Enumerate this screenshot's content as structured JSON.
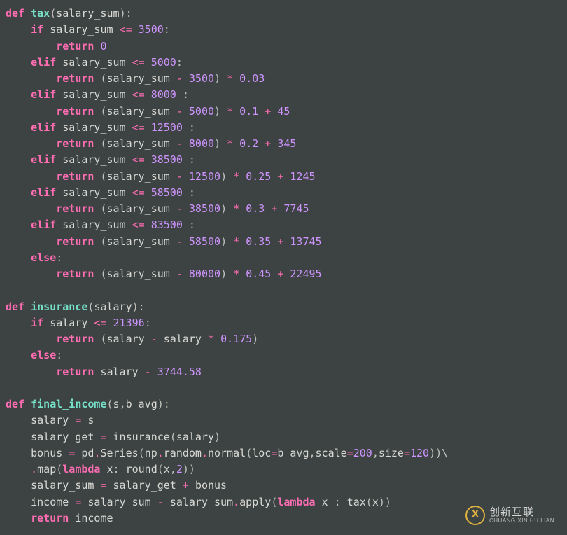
{
  "code": {
    "lines": [
      [
        [
          "kw",
          "def "
        ],
        [
          "fn",
          "tax"
        ],
        [
          "pun",
          "("
        ],
        [
          "id",
          "salary_sum"
        ],
        [
          "pun",
          "):"
        ]
      ],
      [
        [
          "pun",
          "    "
        ],
        [
          "kw",
          "if"
        ],
        [
          "pun",
          " "
        ],
        [
          "id",
          "salary_sum"
        ],
        [
          "pun",
          " "
        ],
        [
          "op",
          "<="
        ],
        [
          "pun",
          " "
        ],
        [
          "num",
          "3500"
        ],
        [
          "pun",
          ":"
        ]
      ],
      [
        [
          "pun",
          "        "
        ],
        [
          "kw",
          "return"
        ],
        [
          "pun",
          " "
        ],
        [
          "num",
          "0"
        ]
      ],
      [
        [
          "pun",
          "    "
        ],
        [
          "kw",
          "elif"
        ],
        [
          "pun",
          " "
        ],
        [
          "id",
          "salary_sum"
        ],
        [
          "pun",
          " "
        ],
        [
          "op",
          "<="
        ],
        [
          "pun",
          " "
        ],
        [
          "num",
          "5000"
        ],
        [
          "pun",
          ":"
        ]
      ],
      [
        [
          "pun",
          "        "
        ],
        [
          "kw",
          "return"
        ],
        [
          "pun",
          " ("
        ],
        [
          "id",
          "salary_sum"
        ],
        [
          "pun",
          " "
        ],
        [
          "op",
          "-"
        ],
        [
          "pun",
          " "
        ],
        [
          "num",
          "3500"
        ],
        [
          "pun",
          ") "
        ],
        [
          "op",
          "*"
        ],
        [
          "pun",
          " "
        ],
        [
          "num",
          "0.03"
        ]
      ],
      [
        [
          "pun",
          "    "
        ],
        [
          "kw",
          "elif"
        ],
        [
          "pun",
          " "
        ],
        [
          "id",
          "salary_sum"
        ],
        [
          "pun",
          " "
        ],
        [
          "op",
          "<="
        ],
        [
          "pun",
          " "
        ],
        [
          "num",
          "8000"
        ],
        [
          "pun",
          " :"
        ]
      ],
      [
        [
          "pun",
          "        "
        ],
        [
          "kw",
          "return"
        ],
        [
          "pun",
          " ("
        ],
        [
          "id",
          "salary_sum"
        ],
        [
          "pun",
          " "
        ],
        [
          "op",
          "-"
        ],
        [
          "pun",
          " "
        ],
        [
          "num",
          "5000"
        ],
        [
          "pun",
          ") "
        ],
        [
          "op",
          "*"
        ],
        [
          "pun",
          " "
        ],
        [
          "num",
          "0.1"
        ],
        [
          "pun",
          " "
        ],
        [
          "op",
          "+"
        ],
        [
          "pun",
          " "
        ],
        [
          "num",
          "45"
        ]
      ],
      [
        [
          "pun",
          "    "
        ],
        [
          "kw",
          "elif"
        ],
        [
          "pun",
          " "
        ],
        [
          "id",
          "salary_sum"
        ],
        [
          "pun",
          " "
        ],
        [
          "op",
          "<="
        ],
        [
          "pun",
          " "
        ],
        [
          "num",
          "12500"
        ],
        [
          "pun",
          " :"
        ]
      ],
      [
        [
          "pun",
          "        "
        ],
        [
          "kw",
          "return"
        ],
        [
          "pun",
          " ("
        ],
        [
          "id",
          "salary_sum"
        ],
        [
          "pun",
          " "
        ],
        [
          "op",
          "-"
        ],
        [
          "pun",
          " "
        ],
        [
          "num",
          "8000"
        ],
        [
          "pun",
          ") "
        ],
        [
          "op",
          "*"
        ],
        [
          "pun",
          " "
        ],
        [
          "num",
          "0.2"
        ],
        [
          "pun",
          " "
        ],
        [
          "op",
          "+"
        ],
        [
          "pun",
          " "
        ],
        [
          "num",
          "345"
        ]
      ],
      [
        [
          "pun",
          "    "
        ],
        [
          "kw",
          "elif"
        ],
        [
          "pun",
          " "
        ],
        [
          "id",
          "salary_sum"
        ],
        [
          "pun",
          " "
        ],
        [
          "op",
          "<="
        ],
        [
          "pun",
          " "
        ],
        [
          "num",
          "38500"
        ],
        [
          "pun",
          " :"
        ]
      ],
      [
        [
          "pun",
          "        "
        ],
        [
          "kw",
          "return"
        ],
        [
          "pun",
          " ("
        ],
        [
          "id",
          "salary_sum"
        ],
        [
          "pun",
          " "
        ],
        [
          "op",
          "-"
        ],
        [
          "pun",
          " "
        ],
        [
          "num",
          "12500"
        ],
        [
          "pun",
          ") "
        ],
        [
          "op",
          "*"
        ],
        [
          "pun",
          " "
        ],
        [
          "num",
          "0.25"
        ],
        [
          "pun",
          " "
        ],
        [
          "op",
          "+"
        ],
        [
          "pun",
          " "
        ],
        [
          "num",
          "1245"
        ]
      ],
      [
        [
          "pun",
          "    "
        ],
        [
          "kw",
          "elif"
        ],
        [
          "pun",
          " "
        ],
        [
          "id",
          "salary_sum"
        ],
        [
          "pun",
          " "
        ],
        [
          "op",
          "<="
        ],
        [
          "pun",
          " "
        ],
        [
          "num",
          "58500"
        ],
        [
          "pun",
          " :"
        ]
      ],
      [
        [
          "pun",
          "        "
        ],
        [
          "kw",
          "return"
        ],
        [
          "pun",
          " ("
        ],
        [
          "id",
          "salary_sum"
        ],
        [
          "pun",
          " "
        ],
        [
          "op",
          "-"
        ],
        [
          "pun",
          " "
        ],
        [
          "num",
          "38500"
        ],
        [
          "pun",
          ") "
        ],
        [
          "op",
          "*"
        ],
        [
          "pun",
          " "
        ],
        [
          "num",
          "0.3"
        ],
        [
          "pun",
          " "
        ],
        [
          "op",
          "+"
        ],
        [
          "pun",
          " "
        ],
        [
          "num",
          "7745"
        ]
      ],
      [
        [
          "pun",
          "    "
        ],
        [
          "kw",
          "elif"
        ],
        [
          "pun",
          " "
        ],
        [
          "id",
          "salary_sum"
        ],
        [
          "pun",
          " "
        ],
        [
          "op",
          "<="
        ],
        [
          "pun",
          " "
        ],
        [
          "num",
          "83500"
        ],
        [
          "pun",
          " :"
        ]
      ],
      [
        [
          "pun",
          "        "
        ],
        [
          "kw",
          "return"
        ],
        [
          "pun",
          " ("
        ],
        [
          "id",
          "salary_sum"
        ],
        [
          "pun",
          " "
        ],
        [
          "op",
          "-"
        ],
        [
          "pun",
          " "
        ],
        [
          "num",
          "58500"
        ],
        [
          "pun",
          ") "
        ],
        [
          "op",
          "*"
        ],
        [
          "pun",
          " "
        ],
        [
          "num",
          "0.35"
        ],
        [
          "pun",
          " "
        ],
        [
          "op",
          "+"
        ],
        [
          "pun",
          " "
        ],
        [
          "num",
          "13745"
        ]
      ],
      [
        [
          "pun",
          "    "
        ],
        [
          "kw",
          "else"
        ],
        [
          "pun",
          ":"
        ]
      ],
      [
        [
          "pun",
          "        "
        ],
        [
          "kw",
          "return"
        ],
        [
          "pun",
          " ("
        ],
        [
          "id",
          "salary_sum"
        ],
        [
          "pun",
          " "
        ],
        [
          "op",
          "-"
        ],
        [
          "pun",
          " "
        ],
        [
          "num",
          "80000"
        ],
        [
          "pun",
          ") "
        ],
        [
          "op",
          "*"
        ],
        [
          "pun",
          " "
        ],
        [
          "num",
          "0.45"
        ],
        [
          "pun",
          " "
        ],
        [
          "op",
          "+"
        ],
        [
          "pun",
          " "
        ],
        [
          "num",
          "22495"
        ]
      ],
      [
        [
          "pun",
          ""
        ]
      ],
      [
        [
          "kw",
          "def "
        ],
        [
          "fn",
          "insurance"
        ],
        [
          "pun",
          "("
        ],
        [
          "id",
          "salary"
        ],
        [
          "pun",
          "):"
        ]
      ],
      [
        [
          "pun",
          "    "
        ],
        [
          "kw",
          "if"
        ],
        [
          "pun",
          " "
        ],
        [
          "id",
          "salary"
        ],
        [
          "pun",
          " "
        ],
        [
          "op",
          "<="
        ],
        [
          "pun",
          " "
        ],
        [
          "num",
          "21396"
        ],
        [
          "pun",
          ":"
        ]
      ],
      [
        [
          "pun",
          "        "
        ],
        [
          "kw",
          "return"
        ],
        [
          "pun",
          " ("
        ],
        [
          "id",
          "salary"
        ],
        [
          "pun",
          " "
        ],
        [
          "op",
          "-"
        ],
        [
          "pun",
          " "
        ],
        [
          "id",
          "salary"
        ],
        [
          "pun",
          " "
        ],
        [
          "op",
          "*"
        ],
        [
          "pun",
          " "
        ],
        [
          "num",
          "0.175"
        ],
        [
          "pun",
          ")"
        ]
      ],
      [
        [
          "pun",
          "    "
        ],
        [
          "kw",
          "else"
        ],
        [
          "pun",
          ":"
        ]
      ],
      [
        [
          "pun",
          "        "
        ],
        [
          "kw",
          "return"
        ],
        [
          "pun",
          " "
        ],
        [
          "id",
          "salary"
        ],
        [
          "pun",
          " "
        ],
        [
          "op",
          "-"
        ],
        [
          "pun",
          " "
        ],
        [
          "num",
          "3744.58"
        ]
      ],
      [
        [
          "pun",
          ""
        ]
      ],
      [
        [
          "kw",
          "def "
        ],
        [
          "fn",
          "final_income"
        ],
        [
          "pun",
          "("
        ],
        [
          "id",
          "s"
        ],
        [
          "pun",
          ","
        ],
        [
          "id",
          "b_avg"
        ],
        [
          "pun",
          "):"
        ]
      ],
      [
        [
          "pun",
          "    "
        ],
        [
          "id",
          "salary"
        ],
        [
          "pun",
          " "
        ],
        [
          "op",
          "="
        ],
        [
          "pun",
          " "
        ],
        [
          "id",
          "s"
        ]
      ],
      [
        [
          "pun",
          "    "
        ],
        [
          "id",
          "salary_get"
        ],
        [
          "pun",
          " "
        ],
        [
          "op",
          "="
        ],
        [
          "pun",
          " "
        ],
        [
          "id",
          "insurance"
        ],
        [
          "pun",
          "("
        ],
        [
          "id",
          "salary"
        ],
        [
          "pun",
          ")"
        ]
      ],
      [
        [
          "pun",
          "    "
        ],
        [
          "id",
          "bonus"
        ],
        [
          "pun",
          " "
        ],
        [
          "op",
          "="
        ],
        [
          "pun",
          " "
        ],
        [
          "id",
          "pd"
        ],
        [
          "op",
          "."
        ],
        [
          "id",
          "Series"
        ],
        [
          "pun",
          "("
        ],
        [
          "id",
          "np"
        ],
        [
          "op",
          "."
        ],
        [
          "id",
          "random"
        ],
        [
          "op",
          "."
        ],
        [
          "id",
          "normal"
        ],
        [
          "pun",
          "("
        ],
        [
          "id",
          "loc"
        ],
        [
          "op",
          "="
        ],
        [
          "id",
          "b_avg"
        ],
        [
          "pun",
          ","
        ],
        [
          "id",
          "scale"
        ],
        [
          "op",
          "="
        ],
        [
          "num",
          "200"
        ],
        [
          "pun",
          ","
        ],
        [
          "id",
          "size"
        ],
        [
          "op",
          "="
        ],
        [
          "num",
          "120"
        ],
        [
          "pun",
          "))\\"
        ]
      ],
      [
        [
          "pun",
          "    "
        ],
        [
          "op",
          "."
        ],
        [
          "id",
          "map"
        ],
        [
          "pun",
          "("
        ],
        [
          "kw",
          "lambda"
        ],
        [
          "pun",
          " "
        ],
        [
          "id",
          "x"
        ],
        [
          "pun",
          ": "
        ],
        [
          "id",
          "round"
        ],
        [
          "pun",
          "("
        ],
        [
          "id",
          "x"
        ],
        [
          "pun",
          ","
        ],
        [
          "num",
          "2"
        ],
        [
          "pun",
          "))"
        ]
      ],
      [
        [
          "pun",
          "    "
        ],
        [
          "id",
          "salary_sum"
        ],
        [
          "pun",
          " "
        ],
        [
          "op",
          "="
        ],
        [
          "pun",
          " "
        ],
        [
          "id",
          "salary_get"
        ],
        [
          "pun",
          " "
        ],
        [
          "op",
          "+"
        ],
        [
          "pun",
          " "
        ],
        [
          "id",
          "bonus"
        ]
      ],
      [
        [
          "pun",
          "    "
        ],
        [
          "id",
          "income"
        ],
        [
          "pun",
          " "
        ],
        [
          "op",
          "="
        ],
        [
          "pun",
          " "
        ],
        [
          "id",
          "salary_sum"
        ],
        [
          "pun",
          " "
        ],
        [
          "op",
          "-"
        ],
        [
          "pun",
          " "
        ],
        [
          "id",
          "salary_sum"
        ],
        [
          "op",
          "."
        ],
        [
          "id",
          "apply"
        ],
        [
          "pun",
          "("
        ],
        [
          "kw",
          "lambda"
        ],
        [
          "pun",
          " "
        ],
        [
          "id",
          "x"
        ],
        [
          "pun",
          " : "
        ],
        [
          "id",
          "tax"
        ],
        [
          "pun",
          "("
        ],
        [
          "id",
          "x"
        ],
        [
          "pun",
          "))"
        ]
      ],
      [
        [
          "pun",
          "    "
        ],
        [
          "kw",
          "return"
        ],
        [
          "pun",
          " "
        ],
        [
          "id",
          "income"
        ]
      ]
    ]
  },
  "watermark": {
    "cn": "创新互联",
    "py": "CHUANG XIN HU LIAN"
  }
}
